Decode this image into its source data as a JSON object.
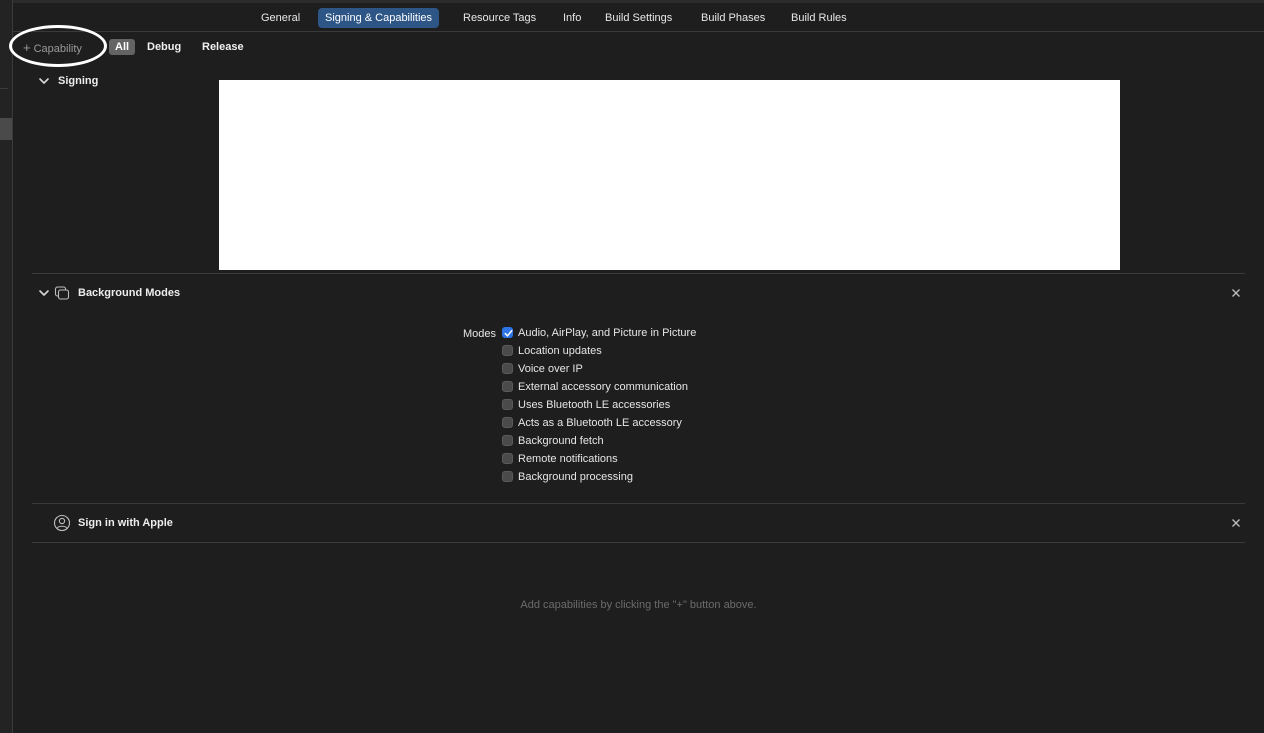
{
  "tabs": [
    {
      "label": "General",
      "active": false
    },
    {
      "label": "Signing & Capabilities",
      "active": true
    },
    {
      "label": "Resource Tags",
      "active": false
    },
    {
      "label": "Info",
      "active": false
    },
    {
      "label": "Build Settings",
      "active": false
    },
    {
      "label": "Build Phases",
      "active": false
    },
    {
      "label": "Build Rules",
      "active": false
    }
  ],
  "toolbar": {
    "add_capability_label": "Capability",
    "config_filters": [
      {
        "label": "All",
        "active": true
      },
      {
        "label": "Debug",
        "active": false
      },
      {
        "label": "Release",
        "active": false
      }
    ]
  },
  "sections": {
    "signing": {
      "title": "Signing",
      "icon": "chevron-down-icon"
    },
    "background_modes": {
      "title": "Background Modes",
      "icon": "background-modes-icon",
      "modes_label": "Modes",
      "modes": [
        {
          "label": "Audio, AirPlay, and Picture in Picture",
          "checked": true
        },
        {
          "label": "Location updates",
          "checked": false
        },
        {
          "label": "Voice over IP",
          "checked": false
        },
        {
          "label": "External accessory communication",
          "checked": false
        },
        {
          "label": "Uses Bluetooth LE accessories",
          "checked": false
        },
        {
          "label": "Acts as a Bluetooth LE accessory",
          "checked": false
        },
        {
          "label": "Background fetch",
          "checked": false
        },
        {
          "label": "Remote notifications",
          "checked": false
        },
        {
          "label": "Background processing",
          "checked": false
        }
      ]
    },
    "sign_in_with_apple": {
      "title": "Sign in with Apple",
      "icon": "person-circle-icon"
    }
  },
  "hint": "Add capabilities by clicking the \"+\" button above.",
  "colors": {
    "background": "#1e1e1e",
    "active_tab": "#2d5586",
    "checkbox_checked": "#2f74e6",
    "annotation_ring": "#ffffff"
  }
}
